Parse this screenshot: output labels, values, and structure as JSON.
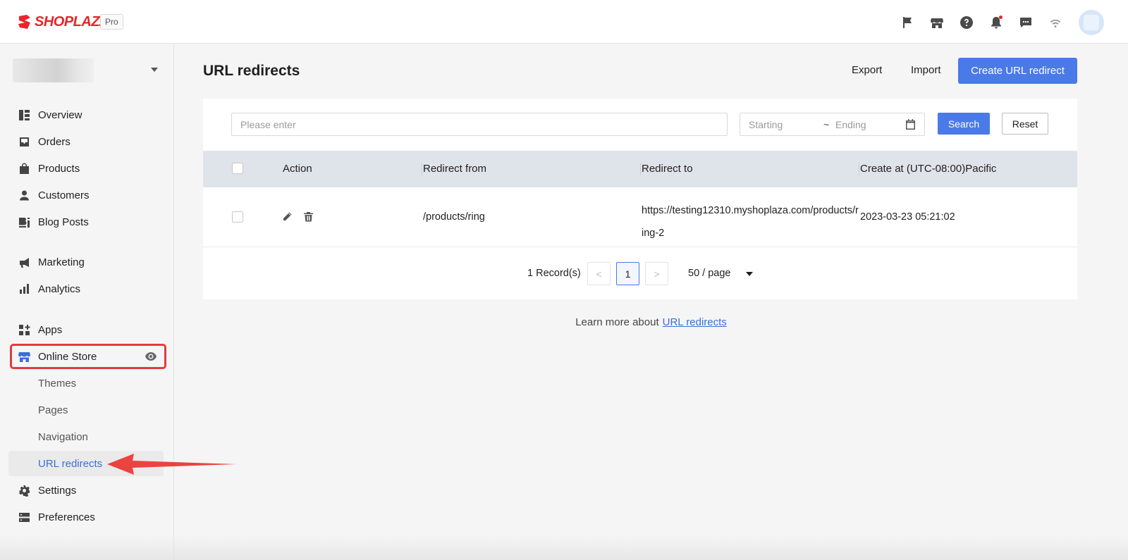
{
  "brand": {
    "name": "SHOPLAZZA",
    "plan_badge": "Pro"
  },
  "sidebar": {
    "items": [
      {
        "label": "Overview",
        "icon": "overview-icon"
      },
      {
        "label": "Orders",
        "icon": "inbox-icon"
      },
      {
        "label": "Products",
        "icon": "bag-icon"
      },
      {
        "label": "Customers",
        "icon": "person-icon"
      },
      {
        "label": "Blog Posts",
        "icon": "blog-icon"
      },
      {
        "label": "Marketing",
        "icon": "megaphone-icon"
      },
      {
        "label": "Analytics",
        "icon": "bar-chart-icon"
      },
      {
        "label": "Apps",
        "icon": "apps-icon"
      },
      {
        "label": "Online Store",
        "icon": "store-icon"
      },
      {
        "label": "Themes"
      },
      {
        "label": "Pages"
      },
      {
        "label": "Navigation"
      },
      {
        "label": "URL redirects"
      },
      {
        "label": "Settings",
        "icon": "gear-icon"
      },
      {
        "label": "Preferences",
        "icon": "preferences-icon"
      }
    ]
  },
  "header": {
    "title": "URL redirects",
    "export_label": "Export",
    "import_label": "Import",
    "create_label": "Create URL redirect"
  },
  "filters": {
    "search_placeholder": "Please enter",
    "date_start_placeholder": "Starting",
    "date_separator": "~",
    "date_end_placeholder": "Ending",
    "search_label": "Search",
    "reset_label": "Reset"
  },
  "table": {
    "columns": [
      "Action",
      "Redirect from",
      "Redirect to",
      "Create at (UTC-08:00)Pacific"
    ],
    "rows": [
      {
        "redirect_from": "/products/ring",
        "redirect_to": "https://testing12310.myshoplaza.com/products/ring-2",
        "created_at": "2023-03-23 05:21:02"
      }
    ]
  },
  "pagination": {
    "record_count": "1 Record(s)",
    "prev": "<",
    "current_page": "1",
    "next": ">",
    "page_size": "50 / page"
  },
  "footer": {
    "learn_more_text": "Learn more about",
    "learn_more_link": "URL redirects"
  },
  "colors": {
    "brand_red": "#e8262a",
    "primary_blue": "#4a7ae8",
    "highlight_red": "#e03d3d",
    "active_link": "#3b6fd8"
  }
}
